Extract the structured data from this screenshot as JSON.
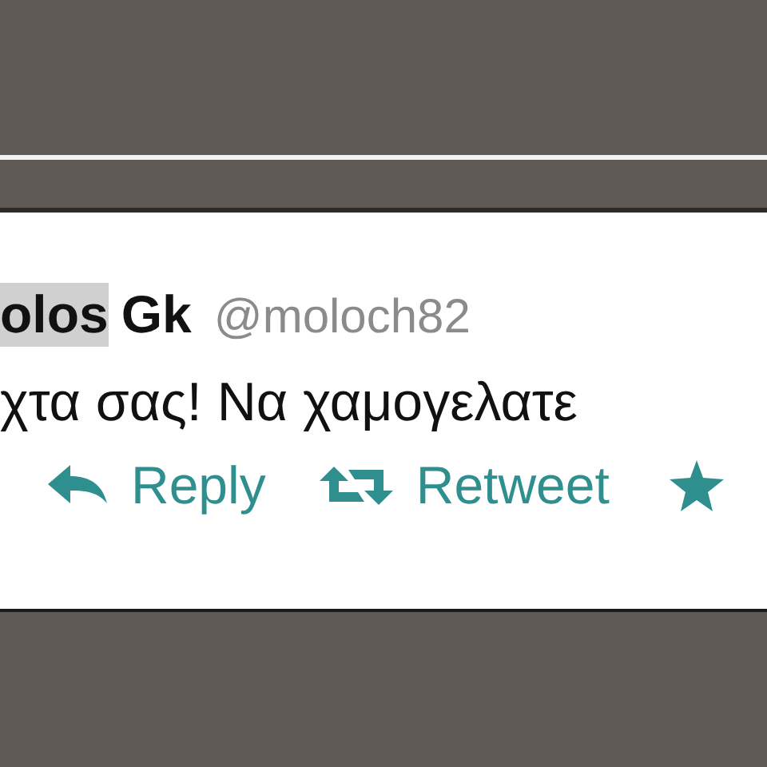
{
  "tweet": {
    "name_parts": [
      {
        "text": "olos",
        "selected": true
      },
      {
        "text": "Gk",
        "selected": false
      }
    ],
    "handle": "@moloch82",
    "text": "χτα σας! Να χαμογελατε",
    "actions": [
      {
        "kind": "reply",
        "label": "Reply"
      },
      {
        "kind": "retweet",
        "label": "Retweet"
      },
      {
        "kind": "favorite"
      }
    ]
  }
}
